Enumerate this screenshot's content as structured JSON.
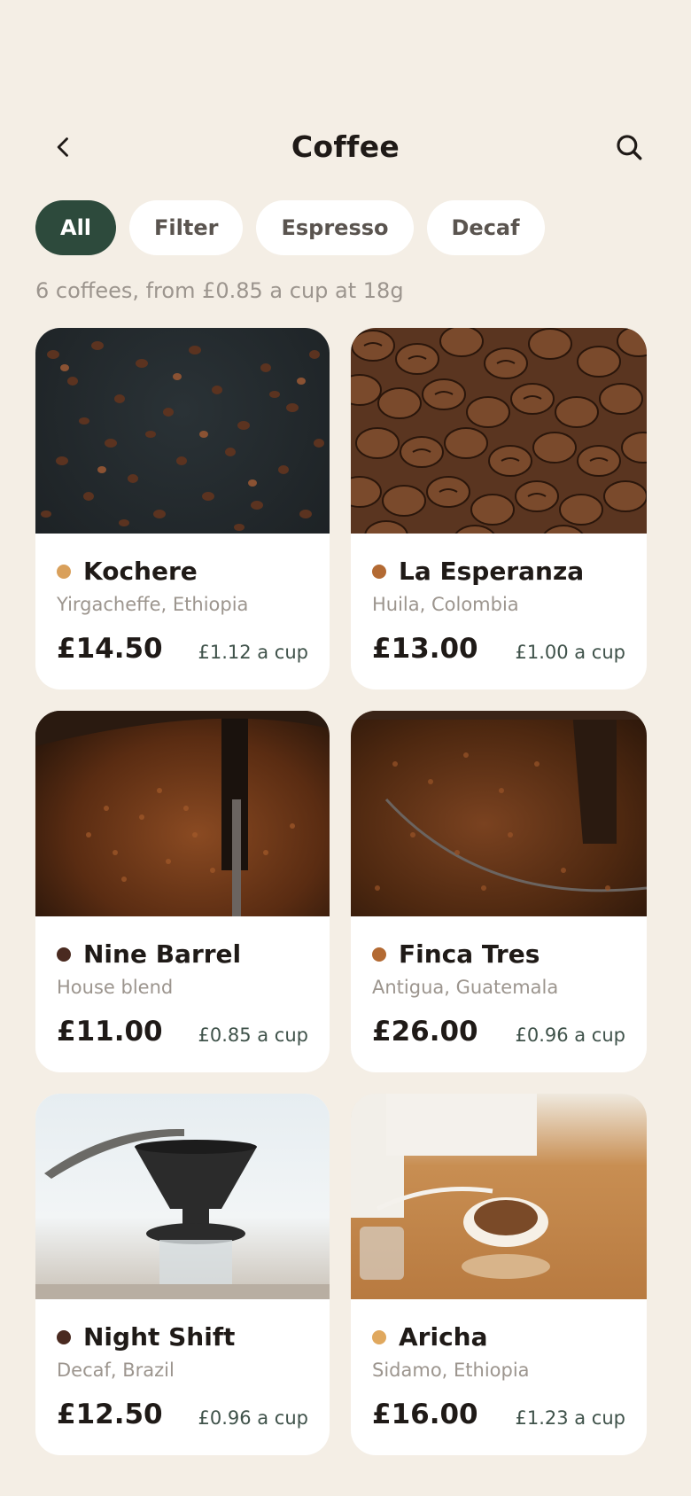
{
  "header": {
    "title": "Coffee"
  },
  "filters": [
    {
      "label": "All",
      "active": true
    },
    {
      "label": "Filter",
      "active": false
    },
    {
      "label": "Espresso",
      "active": false
    },
    {
      "label": "Decaf",
      "active": false
    }
  ],
  "summary": "6 coffees, from £0.85 a cup at 18g",
  "products": [
    {
      "name": "Kochere",
      "origin": "Yirgacheffe, Ethiopia",
      "price": "£14.50",
      "per_cup": "£1.12 a cup",
      "dot_color": "#d9a05b"
    },
    {
      "name": "La Esperanza",
      "origin": "Huila, Colombia",
      "price": "£13.00",
      "per_cup": "£1.00 a cup",
      "dot_color": "#b36a33"
    },
    {
      "name": "Nine Barrel",
      "origin": "House blend",
      "price": "£11.00",
      "per_cup": "£0.85 a cup",
      "dot_color": "#4a2a20"
    },
    {
      "name": "Finca Tres",
      "origin": "Antigua, Guatemala",
      "price": "£26.00",
      "per_cup": "£0.96 a cup",
      "dot_color": "#b36a33"
    },
    {
      "name": "Night Shift",
      "origin": "Decaf, Brazil",
      "price": "£12.50",
      "per_cup": "£0.96 a cup",
      "dot_color": "#4a2a20"
    },
    {
      "name": "Aricha",
      "origin": "Sidamo, Ethiopia",
      "price": "£16.00",
      "per_cup": "£1.23 a cup",
      "dot_color": "#e0a85e"
    }
  ],
  "colors": {
    "background": "#f4eee5",
    "accent": "#2d4a3c",
    "card": "#ffffff"
  },
  "icons": {
    "back": "chevron-left-icon",
    "search": "search-icon"
  }
}
